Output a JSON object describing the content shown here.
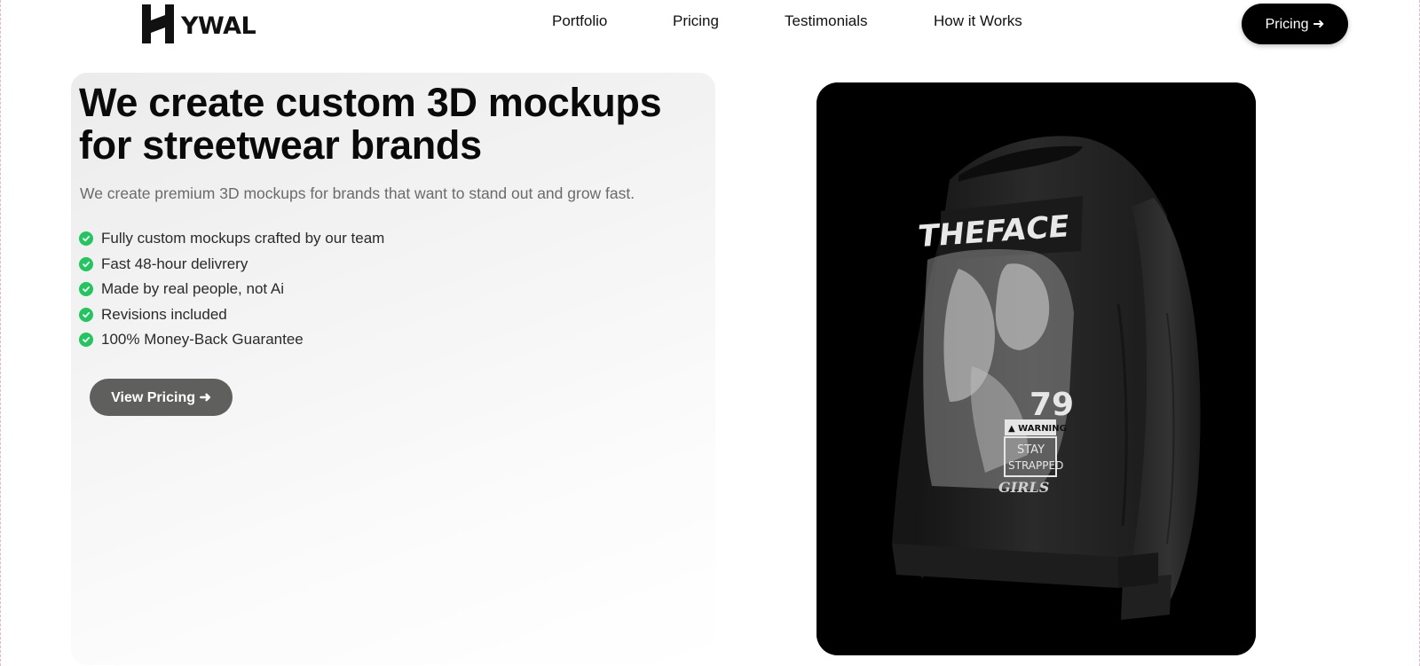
{
  "brand": {
    "name": "YWAL",
    "logo_icon": "h-monogram-icon"
  },
  "nav": {
    "links": [
      "Portfolio",
      "Pricing",
      "Testimonials",
      "How it Works"
    ],
    "cta_label": "Pricing ➜"
  },
  "hero": {
    "title": "We create custom 3D mockups for streetwear brands",
    "subtitle": "We create premium 3D mockups for brands that want to stand out and grow fast.",
    "features": [
      "Fully custom mockups crafted by our team",
      "Fast 48-hour delivrery",
      "Made by real people, not Ai",
      "Revisions included",
      "100% Money-Back Guarantee"
    ],
    "cta_label": "View Pricing ➜"
  },
  "product_image": {
    "print_title": "THEFACE",
    "print_number": "79",
    "warning_label": "▲ WARNING",
    "sign_line1": "STAY",
    "sign_line2": "STRAPPED",
    "script_text": "GIRLS"
  },
  "colors": {
    "accent_check": "#22c55e",
    "header_cta_bg": "#000000",
    "view_pricing_bg": "#5f605e",
    "product_bg": "#000000"
  }
}
